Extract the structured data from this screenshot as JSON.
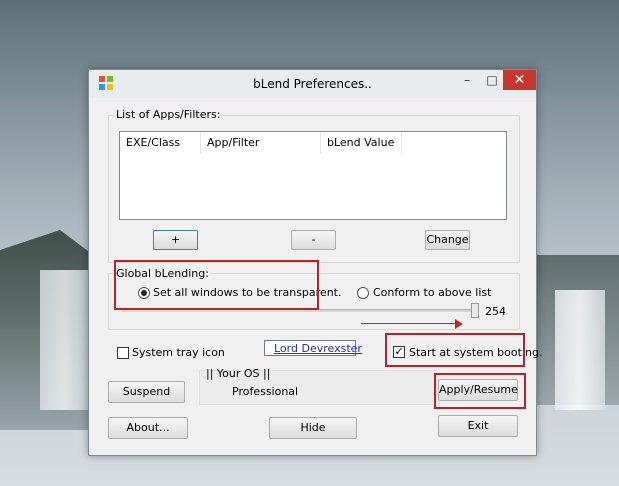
{
  "window": {
    "title": "bLend Preferences..",
    "min_glyph": "–",
    "max_glyph": "□",
    "close_glyph": "✕"
  },
  "apps_group": {
    "label": "List of Apps/Filters:",
    "columns": [
      "EXE/Class",
      "App/Filter",
      "bLend Value"
    ],
    "rows": []
  },
  "buttons": {
    "add": "+",
    "remove": "-",
    "change": "Change",
    "suspend": "Suspend",
    "apply_resume": "Apply/Resume",
    "about": "About...",
    "hide": "Hide",
    "exit": "Exit"
  },
  "global_blending": {
    "label": "Global bLending:",
    "option_all": "Set all windows to be transparent.",
    "option_conform": "Conform to above list",
    "selected": "option_all",
    "slider_value": "254",
    "slider_level": 254,
    "slider_max": 255
  },
  "options": {
    "system_tray_icon": "System tray icon",
    "system_tray_checked": false,
    "start_at_boot": "Start at system booting.",
    "start_at_boot_checked": true,
    "check_glyph": "✓"
  },
  "credit_link": "Lord Devrexster",
  "os": {
    "label": "|| Your OS ||",
    "value": "Professional"
  },
  "icons": {
    "window_icon": "windows-logo-icon"
  },
  "colors": {
    "highlight": "#b32329",
    "close_button": "#c7372f",
    "link": "#1a2fbf"
  }
}
